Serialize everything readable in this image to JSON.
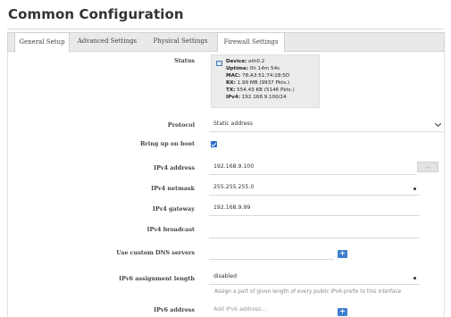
{
  "page": {
    "title": "Common Configuration"
  },
  "tabs": [
    {
      "label": "General Setup",
      "active": true
    },
    {
      "label": "Advanced Settings",
      "active": false
    },
    {
      "label": "Physical Settings",
      "active": false
    },
    {
      "label": "Firewall Settings",
      "active": false
    }
  ],
  "status": {
    "label": "Status",
    "device_label": "Device:",
    "device": "eth0.2",
    "uptime_label": "Uptime:",
    "uptime": "0h 14m 54s",
    "mac_label": "MAC:",
    "mac": "78:A3:51:74:28:5D",
    "rx_label": "RX:",
    "rx": "1.99 MB (9937 Pkts.)",
    "tx_label": "TX:",
    "tx": "554.43 KB (5146 Pkts.)",
    "ipv4_label": "IPv4:",
    "ipv4": "192.168.9.100/24"
  },
  "protocol": {
    "label": "Protocol",
    "value": "Static address"
  },
  "boot": {
    "label": "Bring up on boot",
    "checked": true
  },
  "ipv4_address": {
    "label": "IPv4 address",
    "value": "192.168.9.100",
    "button": "..."
  },
  "ipv4_netmask": {
    "label": "IPv4 netmask",
    "value": "255.255.255.0"
  },
  "ipv4_gateway": {
    "label": "IPv4 gateway",
    "value": "192.168.9.99"
  },
  "ipv4_broadcast": {
    "label": "IPv4 broadcast",
    "value": ""
  },
  "custom_dns": {
    "label": "Use custom DNS servers",
    "value": "",
    "button": "+"
  },
  "ipv6_assign": {
    "label": "IPv6 assignment length",
    "value": "disabled",
    "hint": "Assign a part of given length of every public IPv6-prefix to this interface"
  },
  "ipv6_address": {
    "label": "IPv6 address",
    "placeholder": "Add IPv6 address...",
    "button": "+"
  },
  "colors": {
    "accent": "#3f7fce",
    "tab_bar": "#e9e9e9",
    "status_bg": "#ececec"
  }
}
